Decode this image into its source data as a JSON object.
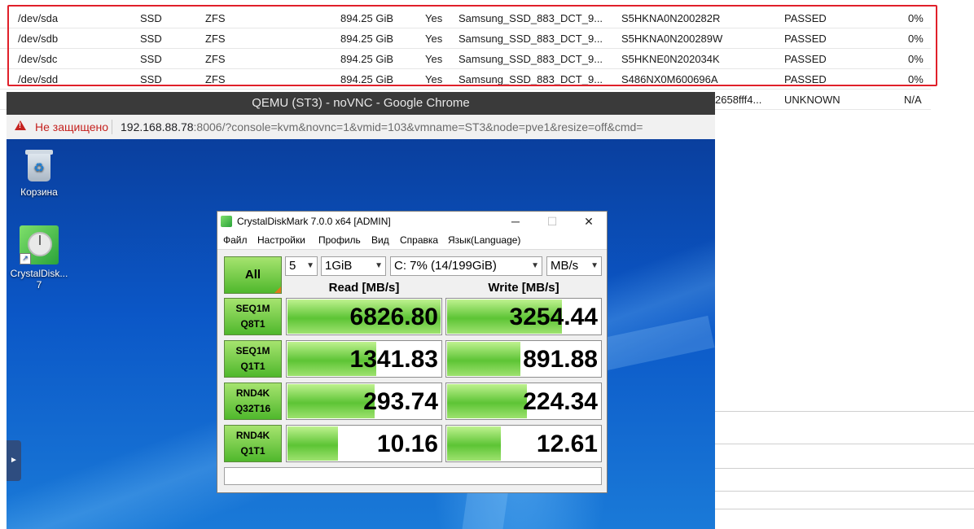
{
  "disk_table": {
    "rows": [
      {
        "device": "/dev/sda",
        "type": "SSD",
        "usage": "ZFS",
        "size": "894.25 GiB",
        "gpt": "Yes",
        "model": "Samsung_SSD_883_DCT_9...",
        "serial": "S5HKNA0N200282R",
        "smart": "PASSED",
        "wearout": "0%"
      },
      {
        "device": "/dev/sdb",
        "type": "SSD",
        "usage": "ZFS",
        "size": "894.25 GiB",
        "gpt": "Yes",
        "model": "Samsung_SSD_883_DCT_9...",
        "serial": "S5HKNA0N200289W",
        "smart": "PASSED",
        "wearout": "0%"
      },
      {
        "device": "/dev/sdc",
        "type": "SSD",
        "usage": "ZFS",
        "size": "894.25 GiB",
        "gpt": "Yes",
        "model": "Samsung_SSD_883_DCT_9...",
        "serial": "S5HKNE0N202034K",
        "smart": "PASSED",
        "wearout": "0%"
      },
      {
        "device": "/dev/sdd",
        "type": "SSD",
        "usage": "ZFS",
        "size": "894.25 GiB",
        "gpt": "Yes",
        "model": "Samsung_SSD_883_DCT_9...",
        "serial": "S486NX0M600696A",
        "smart": "PASSED",
        "wearout": "0%"
      }
    ],
    "partial_row": {
      "serial": "2658fff4...",
      "smart": "UNKNOWN",
      "wearout": "N/A"
    },
    "highlight_color": "#e0202a"
  },
  "chrome": {
    "title": "QEMU (ST3) - noVNC - Google Chrome",
    "not_secure": "Не защищено",
    "url_host": "192.168.88.78",
    "url_rest": ":8006/?console=kvm&novnc=1&vmid=103&vmname=ST3&node=pve1&resize=off&cmd="
  },
  "desktop": {
    "icons": [
      {
        "label": "Корзина",
        "icon": "recycle-bin-icon"
      },
      {
        "label": "CrystalDisk...\n7",
        "icon": "crystaldiskmark-icon"
      }
    ],
    "side_tab": "►"
  },
  "cdm": {
    "title": "CrystalDiskMark 7.0.0 x64 [ADMIN]",
    "window_buttons": {
      "minimize": "─",
      "maximize": "☐",
      "close": "✕"
    },
    "menu": [
      "Файл",
      "Настройки",
      "Профиль",
      "Вид",
      "Справка",
      "Язык(Language)"
    ],
    "all_label": "All",
    "count": "5",
    "size": "1GiB",
    "drive": "C: 7% (14/199GiB)",
    "unit": "MB/s",
    "read_header": "Read [MB/s]",
    "write_header": "Write [MB/s]",
    "tests": [
      {
        "l1": "SEQ1M",
        "l2": "Q8T1",
        "read": "6826.80",
        "write": "3254.44",
        "read_fill": 1.0,
        "write_fill": 0.75
      },
      {
        "l1": "SEQ1M",
        "l2": "Q1T1",
        "read": "1341.83",
        "write": "891.88",
        "read_fill": 0.58,
        "write_fill": 0.48
      },
      {
        "l1": "RND4K",
        "l2": "Q32T16",
        "read": "293.74",
        "write": "224.34",
        "read_fill": 0.57,
        "write_fill": 0.52
      },
      {
        "l1": "RND4K",
        "l2": "Q1T1",
        "read": "10.16",
        "write": "12.61",
        "read_fill": 0.33,
        "write_fill": 0.35
      }
    ],
    "accent_green": "#5dc435"
  }
}
